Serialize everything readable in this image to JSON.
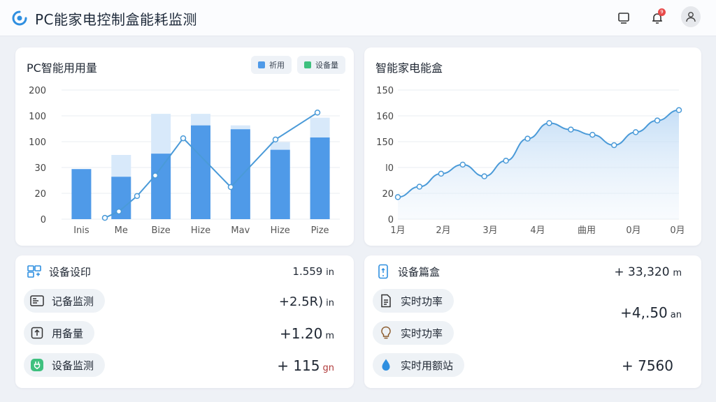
{
  "header": {
    "title": "PC能家电控制盒能耗监测",
    "icons": [
      "monitor-icon",
      "bell-icon",
      "user-icon"
    ],
    "notification_count": "9"
  },
  "colors": {
    "bar": "#4f9ae8",
    "bar_light": "#d8e9fa",
    "line": "#4a9ad8",
    "accent_green": "#3ec07e"
  },
  "chart1": {
    "title": "PC智能用用量",
    "legend": [
      "祈用",
      "设备量"
    ],
    "chart_data": {
      "type": "bar",
      "title": "PC智能用用量",
      "categories": [
        "Inis",
        "Me",
        "Bize",
        "Hize",
        "Mav",
        "Hize",
        "Pize"
      ],
      "ytick_labels": [
        "0",
        "20",
        "30",
        "100",
        "100",
        "200"
      ],
      "series": [
        {
          "name": "祈用",
          "type": "bar",
          "values": [
            1.95,
            1.65,
            2.55,
            3.65,
            3.5,
            2.7,
            3.18
          ]
        },
        {
          "name": "设备量",
          "type": "bar",
          "values": [
            0,
            2.5,
            4.1,
            4.1,
            3.65,
            3.0,
            3.95
          ]
        },
        {
          "type": "line",
          "values": [
            0.05,
            0.3,
            0.9,
            1.7,
            3.15,
            1.25,
            3.1,
            4.15
          ]
        }
      ],
      "ylim": [
        0,
        5
      ]
    }
  },
  "chart2": {
    "title": "智能家电能盒",
    "chart_data": {
      "type": "area",
      "title": "智能家电能盒",
      "categories": [
        "1月",
        "2月",
        "3月",
        "4月",
        "曲用",
        "0月",
        "0月"
      ],
      "ytick_labels": [
        "0",
        "20",
        "l0",
        "150",
        "160",
        "150"
      ],
      "series": [
        {
          "type": "line",
          "values": [
            0.85,
            1.25,
            1.75,
            2.1,
            1.65,
            2.25,
            3.1,
            3.7,
            3.45,
            3.25,
            2.85,
            3.35,
            3.8,
            4.2
          ]
        }
      ],
      "ylim": [
        0,
        5
      ]
    }
  },
  "stats_left": {
    "title": "设备设印",
    "title_value": "1.559",
    "title_unit": "in",
    "rows": [
      {
        "label": "记备监测",
        "value": "+2.5R)",
        "unit": "in",
        "icon": "panel-icon"
      },
      {
        "label": "用备量",
        "value": "+1.20",
        "unit": "m",
        "icon": "up-arrow-icon"
      },
      {
        "label": "设备监测",
        "value": "+ 115",
        "unit": "gn",
        "icon": "plug-icon"
      }
    ]
  },
  "stats_right": {
    "title": "设备篇盒",
    "title_value": "+ 33,320",
    "title_unit": "m",
    "rows": [
      {
        "label": "实时功率",
        "icon": "document-icon"
      },
      {
        "label": "实时功率",
        "icon": "lightbulb-icon"
      },
      {
        "label": "实时用额站",
        "icon": "water-drop-icon"
      }
    ],
    "values": [
      {
        "value": "+4,.50",
        "unit": "an"
      },
      {
        "value": "+ 7560",
        "unit": ""
      }
    ]
  }
}
